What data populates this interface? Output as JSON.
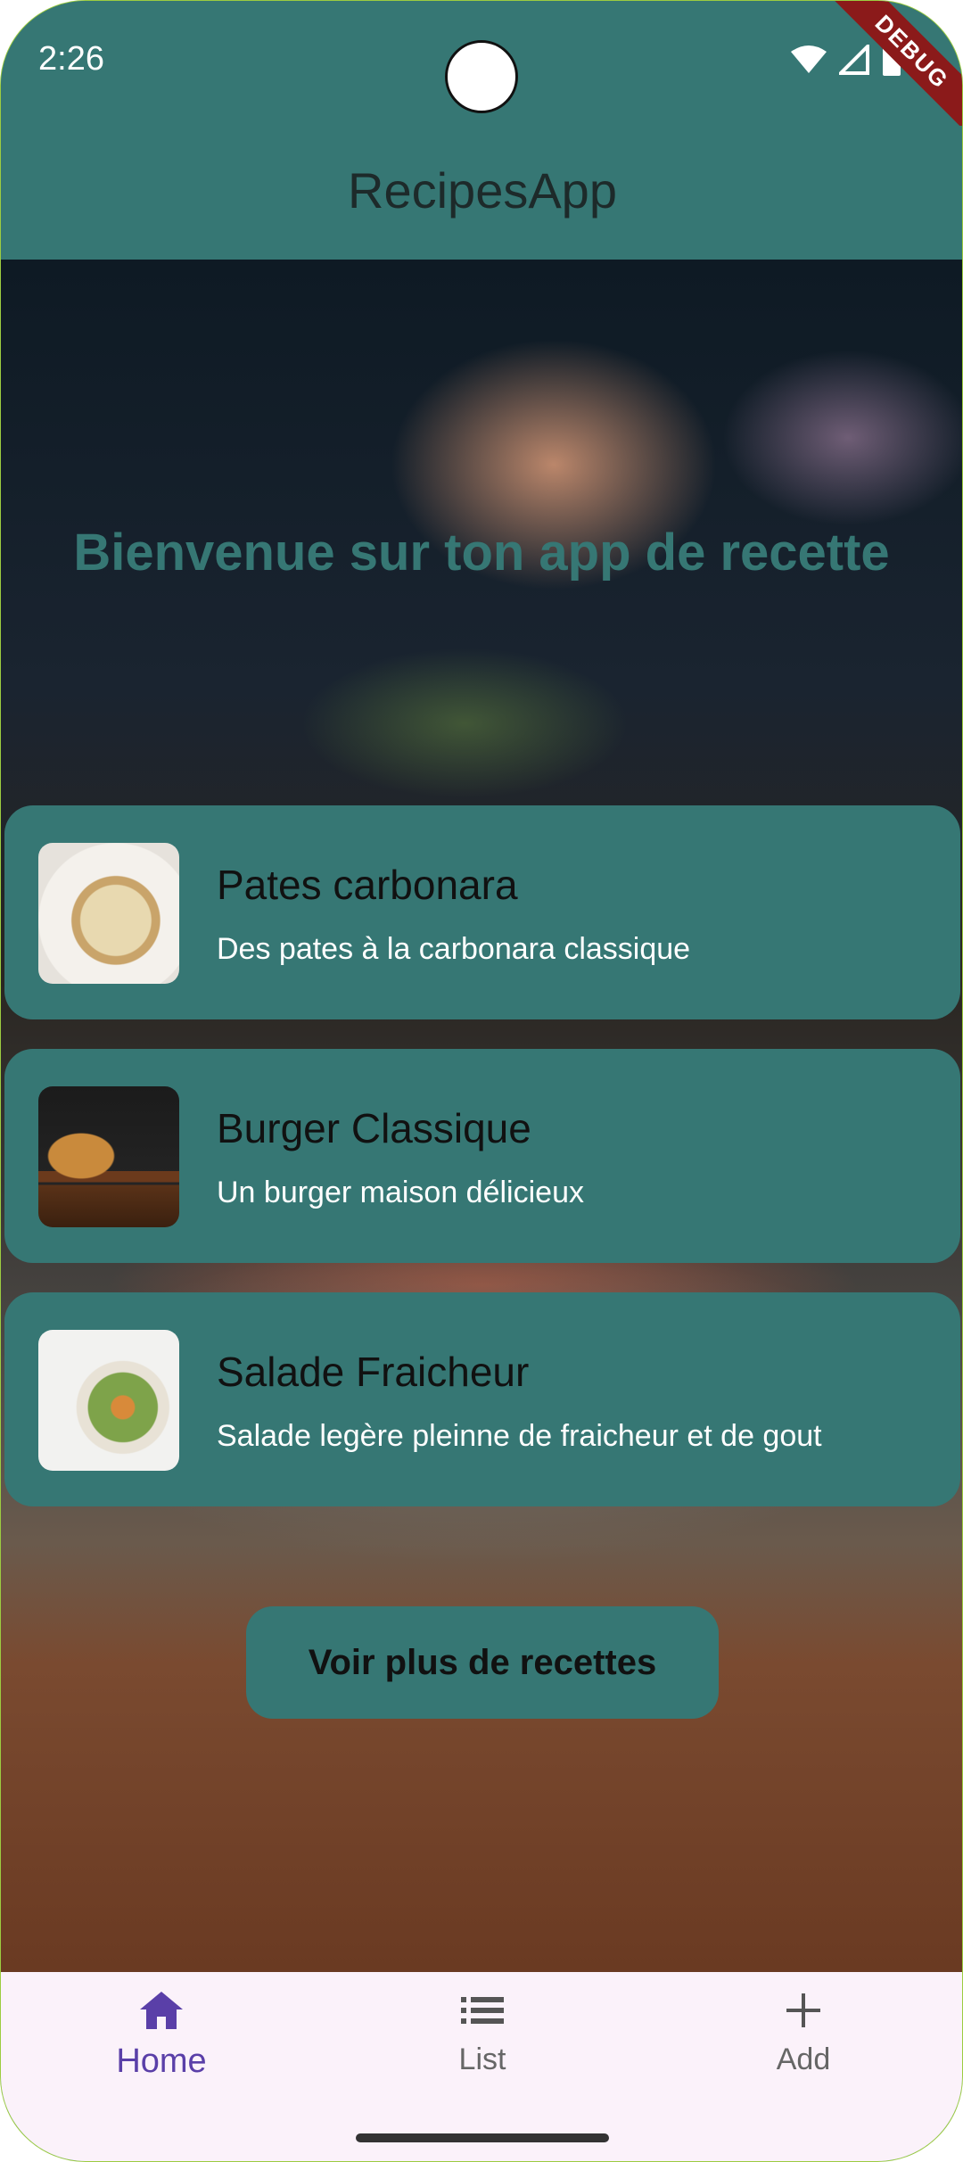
{
  "status_bar": {
    "time": "2:26",
    "debug_label": "DEBUG"
  },
  "app_bar": {
    "title": "RecipesApp"
  },
  "hero": {
    "welcome_text": "Bienvenue sur ton app de recette"
  },
  "recipes": [
    {
      "title": "Pates carbonara",
      "subtitle": "Des pates à la carbonara classique",
      "image": "pasta-image"
    },
    {
      "title": "Burger Classique",
      "subtitle": "Un burger maison délicieux",
      "image": "burger-image"
    },
    {
      "title": "Salade Fraicheur",
      "subtitle": "Salade legère pleinne de fraicheur et de gout",
      "image": "salad-image"
    }
  ],
  "more_button": {
    "label": "Voir plus de recettes"
  },
  "bottom_nav": {
    "items": [
      {
        "label": "Home",
        "icon": "home-icon",
        "active": true
      },
      {
        "label": "List",
        "icon": "list-icon",
        "active": false
      },
      {
        "label": "Add",
        "icon": "add-icon",
        "active": false
      }
    ]
  },
  "colors": {
    "primary": "#367774",
    "nav_background": "#fbf2fa",
    "nav_active": "#5a3fa8"
  }
}
